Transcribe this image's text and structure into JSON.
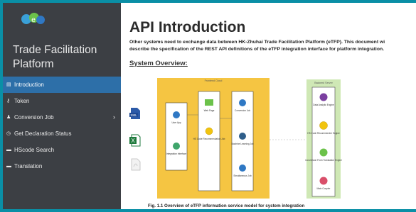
{
  "sidebar": {
    "logo": "eTFP-logo-icon",
    "brand": "Trade Facilitation Platform",
    "items": [
      {
        "label": "Introduction",
        "icon": "document-icon",
        "active": true
      },
      {
        "label": "Token",
        "icon": "key-icon"
      },
      {
        "label": "Conversion Job",
        "icon": "users-icon",
        "has_submenu": true
      },
      {
        "label": "Get Declaration Status",
        "icon": "clock-icon"
      },
      {
        "label": "HScode Search",
        "icon": "book-icon"
      },
      {
        "label": "Translation",
        "icon": "book-icon"
      }
    ],
    "chevron": "›"
  },
  "main": {
    "title": "API Introduction",
    "desc_line1": "Other systems need to exchange data between HK-Zhuhai Trade Facilitation Platform (eTFP). This document wi",
    "desc_line2": "describe the specification of the REST API definitions of the eTFP integration interface for platform integration.",
    "section": "System Overview:",
    "doc_icons": [
      "xml-file-icon",
      "excel-file-icon",
      "pdf-file-icon"
    ],
    "diagram": {
      "left_title": "Frontend Cloud",
      "right_title": "Backend Server",
      "col1": [
        "User App",
        "Integration Interface"
      ],
      "col2": [
        "Web Page",
        "HS Code Recommendation Job"
      ],
      "col3": [
        "Conversion Job",
        "Machine Learning Job",
        "Simultaneous Job"
      ],
      "col4": [
        "Data Analytic Engine",
        "HS Code Recommender Engine",
        "Conversion From Translation Engine",
        "Main Coupler"
      ]
    },
    "caption": "Fig. 1.1 Overview of eTFP information service model for system integration"
  },
  "colors": {
    "frame": "#0a8fa6",
    "sidebar": "#3c3f44",
    "active": "#2d6fa8",
    "frontend_bg": "#f5c542",
    "backend_bg": "#cfe8b5"
  }
}
